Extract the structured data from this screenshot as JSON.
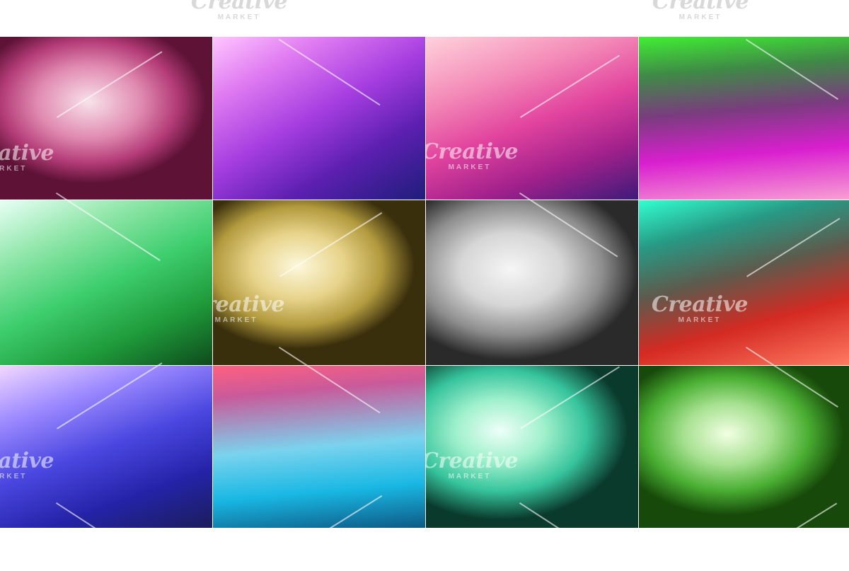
{
  "watermark": {
    "line1": "Creative",
    "line2": "MARKET"
  },
  "tiles": [
    {
      "id": "pink-rose",
      "bg": "radial-gradient(ellipse 55% 50% at 42% 40%, #f8e2ea 0%, #e08ab0 45%, #b43c78 75%, #5e1236 100%)"
    },
    {
      "id": "violet-indigo",
      "bg": "linear-gradient(150deg, #ffc6ff 0%, #e07cf2 22%, #a53de0 48%, #5c1fb0 72%, #1e1e7a 100%)"
    },
    {
      "id": "pink-magenta",
      "bg": "linear-gradient(160deg, #ffd2dc 0%, #f48cb8 28%, #e2449e 52%, #a3218c 75%, #3d1b78 100%)"
    },
    {
      "id": "green-magenta",
      "bg": "linear-gradient(175deg, #41ef34 0%, #3f8a46 22%, #7a3c7e 45%, #d91fcf 70%, #f8a0d4 100%)"
    },
    {
      "id": "mint-green",
      "bg": "linear-gradient(155deg, #e8fff6 0%, #8fe6a8 25%, #3ece6e 50%, #1f9a3a 75%, #0e4a1c 100%)"
    },
    {
      "id": "gold-cream",
      "bg": "radial-gradient(ellipse 55% 50% at 40% 40%, #fdf8dc 0%, #e7d38a 40%, #b29a3e 72%, #3a2f0c 100%)"
    },
    {
      "id": "silver-grey",
      "bg": "radial-gradient(ellipse 60% 55% at 40% 42%, #f6f6f6 0%, #d6d6d6 40%, #8d8d8d 72%, #2a2a2a 100%)"
    },
    {
      "id": "teal-red",
      "bg": "linear-gradient(165deg, #32ffd0 0%, #279a85 22%, #5e5a4c 45%, #d42a22 70%, #ff7a62 100%)"
    },
    {
      "id": "lavender-blue",
      "bg": "linear-gradient(160deg, #f2d8ff 0%, #9a88ff 25%, #4a47e0 50%, #2423a8 75%, #1b1d5a 100%)"
    },
    {
      "id": "rose-cyan",
      "bg": "linear-gradient(175deg, #ff6080 0%, #c95a9a 18%, #7ad3ee 50%, #19b8e4 75%, #0d5a84 100%)"
    },
    {
      "id": "seafoam-teal",
      "bg": "radial-gradient(ellipse 60% 55% at 35% 40%, #eefff7 0%, #9ff0cc 35%, #36c49c 68%, #0a3a2c 100%)"
    },
    {
      "id": "lime-green",
      "bg": "radial-gradient(ellipse 55% 50% at 42% 42%, #f2ffe4 0%, #a6e090 38%, #4aaf32 70%, #174a0a 100%)"
    }
  ]
}
